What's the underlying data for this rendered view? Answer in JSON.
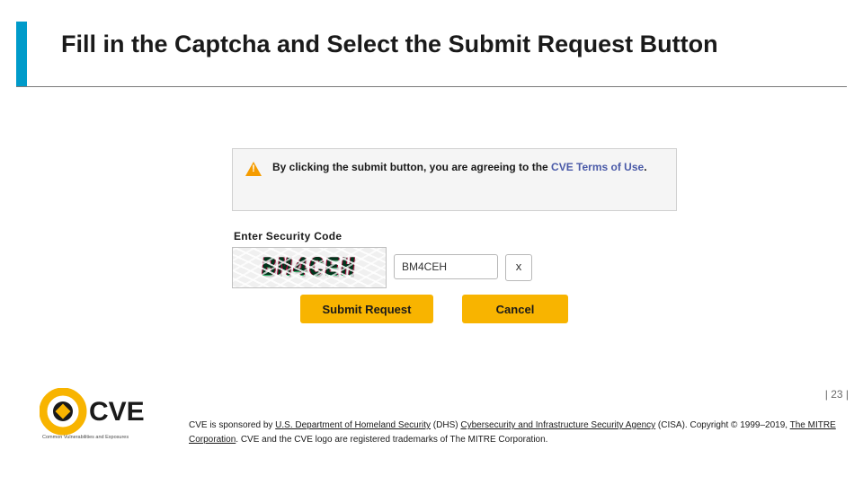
{
  "title": "Fill in the Captcha and Select the Submit Request Button",
  "panel": {
    "text_pre": "By clicking the submit button, you are agreeing to the ",
    "link": "CVE Terms of Use",
    "text_post": "."
  },
  "captcha": {
    "label": "Enter Security Code",
    "image_text": "BM4CEH",
    "input_value": "BM4CEH",
    "clear_label": "x"
  },
  "buttons": {
    "submit": "Submit Request",
    "cancel": "Cancel"
  },
  "page_number": "| 23 |",
  "logo": {
    "tagline": "Common Vulnerabilities and Exposures"
  },
  "footer": {
    "t1": "CVE is sponsored by ",
    "l1": "U.S. Department of Homeland Security",
    "t2": " (DHS) ",
    "l2": "Cybersecurity and Infrastructure Security Agency",
    "t3": " (CISA). Copyright © 1999–2019, ",
    "l3": "The MITRE Corporation",
    "t4": ". CVE and the CVE logo are registered trademarks of The MITRE Corporation."
  }
}
